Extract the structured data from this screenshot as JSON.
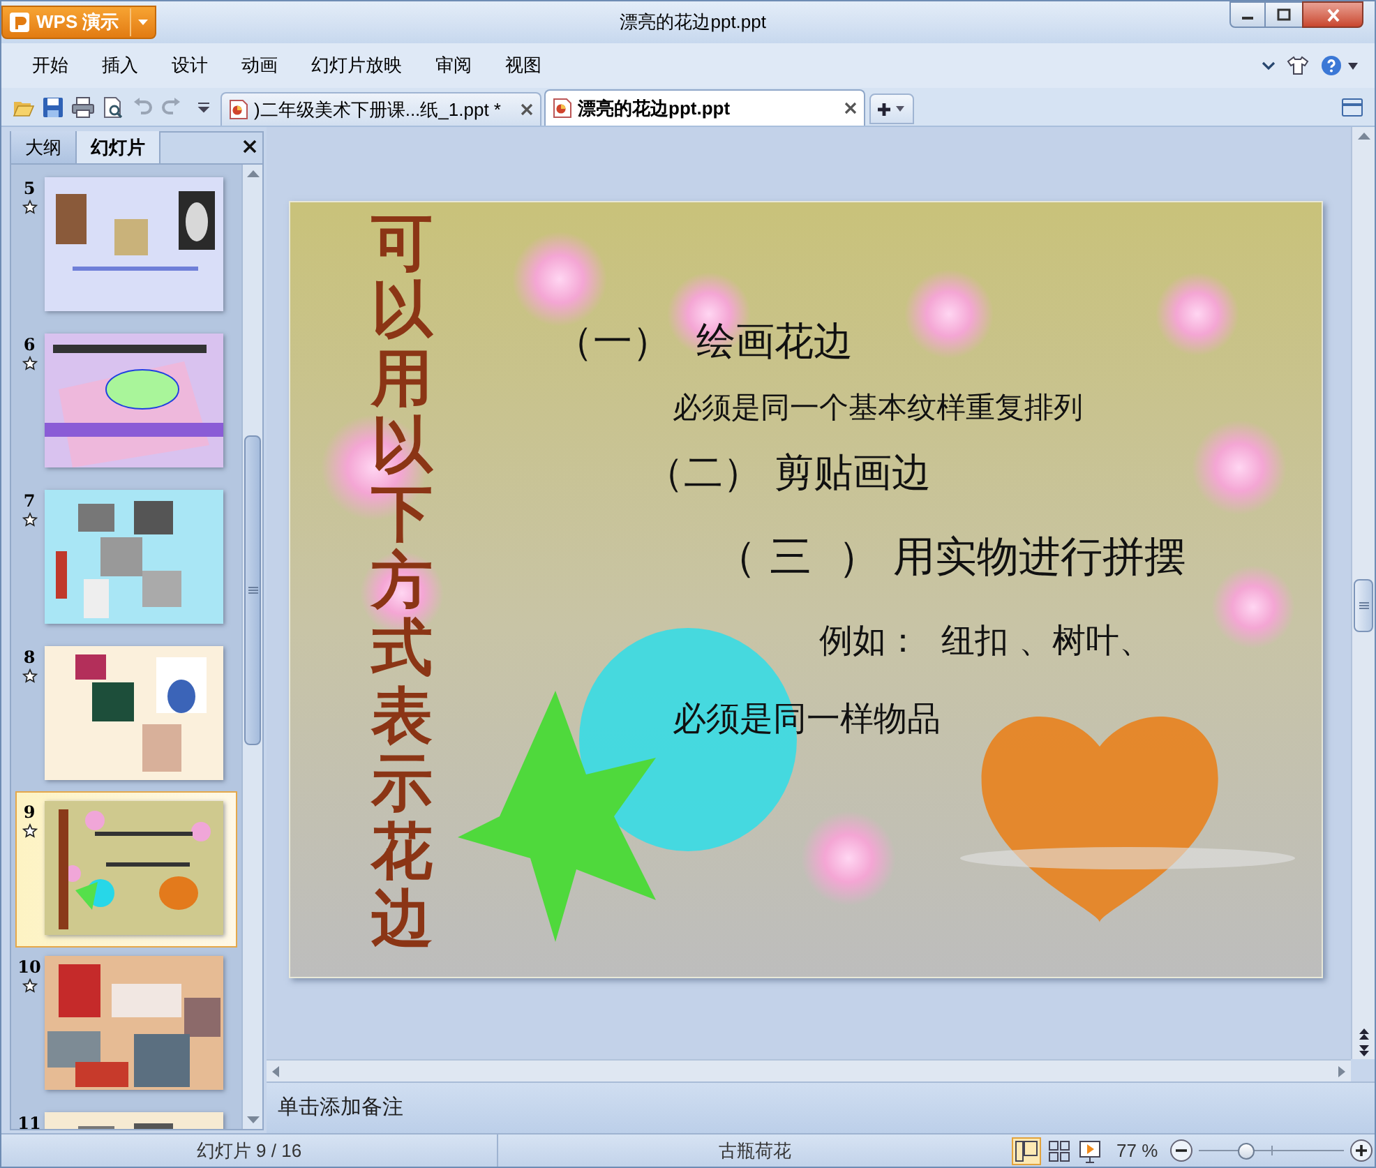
{
  "window": {
    "app_button": "WPS 演示",
    "title": "漂亮的花边ppt.ppt"
  },
  "menu": [
    "开始",
    "插入",
    "设计",
    "动画",
    "幻灯片放映",
    "审阅",
    "视图"
  ],
  "doc_tabs": [
    {
      "label": ")二年级美术下册课...纸_1.ppt *",
      "selected": false
    },
    {
      "label": "漂亮的花边ppt.ppt",
      "selected": true
    }
  ],
  "panel_tabs": [
    {
      "label": "大纲",
      "selected": false
    },
    {
      "label": "幻灯片",
      "selected": true
    }
  ],
  "slides": [
    {
      "number": "5",
      "animated": true,
      "selected": false,
      "color": "#d9def8"
    },
    {
      "number": "6",
      "animated": true,
      "selected": false,
      "color": "#d9c2ef"
    },
    {
      "number": "7",
      "animated": true,
      "selected": false,
      "color": "#a9e6f5"
    },
    {
      "number": "8",
      "animated": true,
      "selected": false,
      "color": "#fbf0dc"
    },
    {
      "number": "9",
      "animated": true,
      "selected": true,
      "color": "#cfc98e"
    },
    {
      "number": "10",
      "animated": true,
      "selected": false,
      "color": "#e6bb94"
    },
    {
      "number": "11",
      "animated": false,
      "selected": false,
      "color": "#f6ead2"
    }
  ],
  "slide": {
    "title": "可以用以下方式表示花边",
    "lines": [
      "（一）  绘画花边",
      "必须是同一个基本纹样重复排列",
      "（二） 剪贴画边",
      "（ 三  ） 用实物进行拼摆",
      "例如：  纽扣 、树叶、",
      "必须是同一样物品"
    ]
  },
  "notes": {
    "placeholder": "单击添加备注"
  },
  "status_bar": {
    "slide_counter": "幻灯片 9 / 16",
    "template": "古瓶荷花",
    "zoom": "77 %",
    "zoom_slider": {
      "level": 0.33
    }
  }
}
